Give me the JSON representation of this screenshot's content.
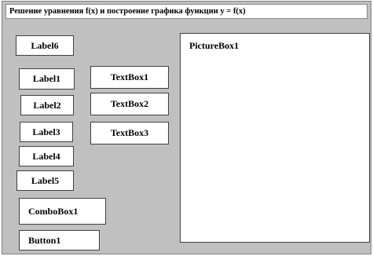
{
  "window": {
    "title": "Решение уравнения f(x) и построение графика функции y = f(x)"
  },
  "controls": {
    "label6": "Label6",
    "label1": "Label1",
    "label2": "Label2",
    "label3": "Label3",
    "label4": "Label4",
    "label5": "Label5",
    "textbox1": "TextBox1",
    "textbox2": "TextBox2",
    "textbox3": "TextBox3",
    "combobox1": "ComboBox1",
    "button1": "Button1",
    "picturebox1": "PictureBox1"
  },
  "colors": {
    "form_background": "#c0c0c0",
    "control_background": "#ffffff",
    "border": "#404040"
  }
}
